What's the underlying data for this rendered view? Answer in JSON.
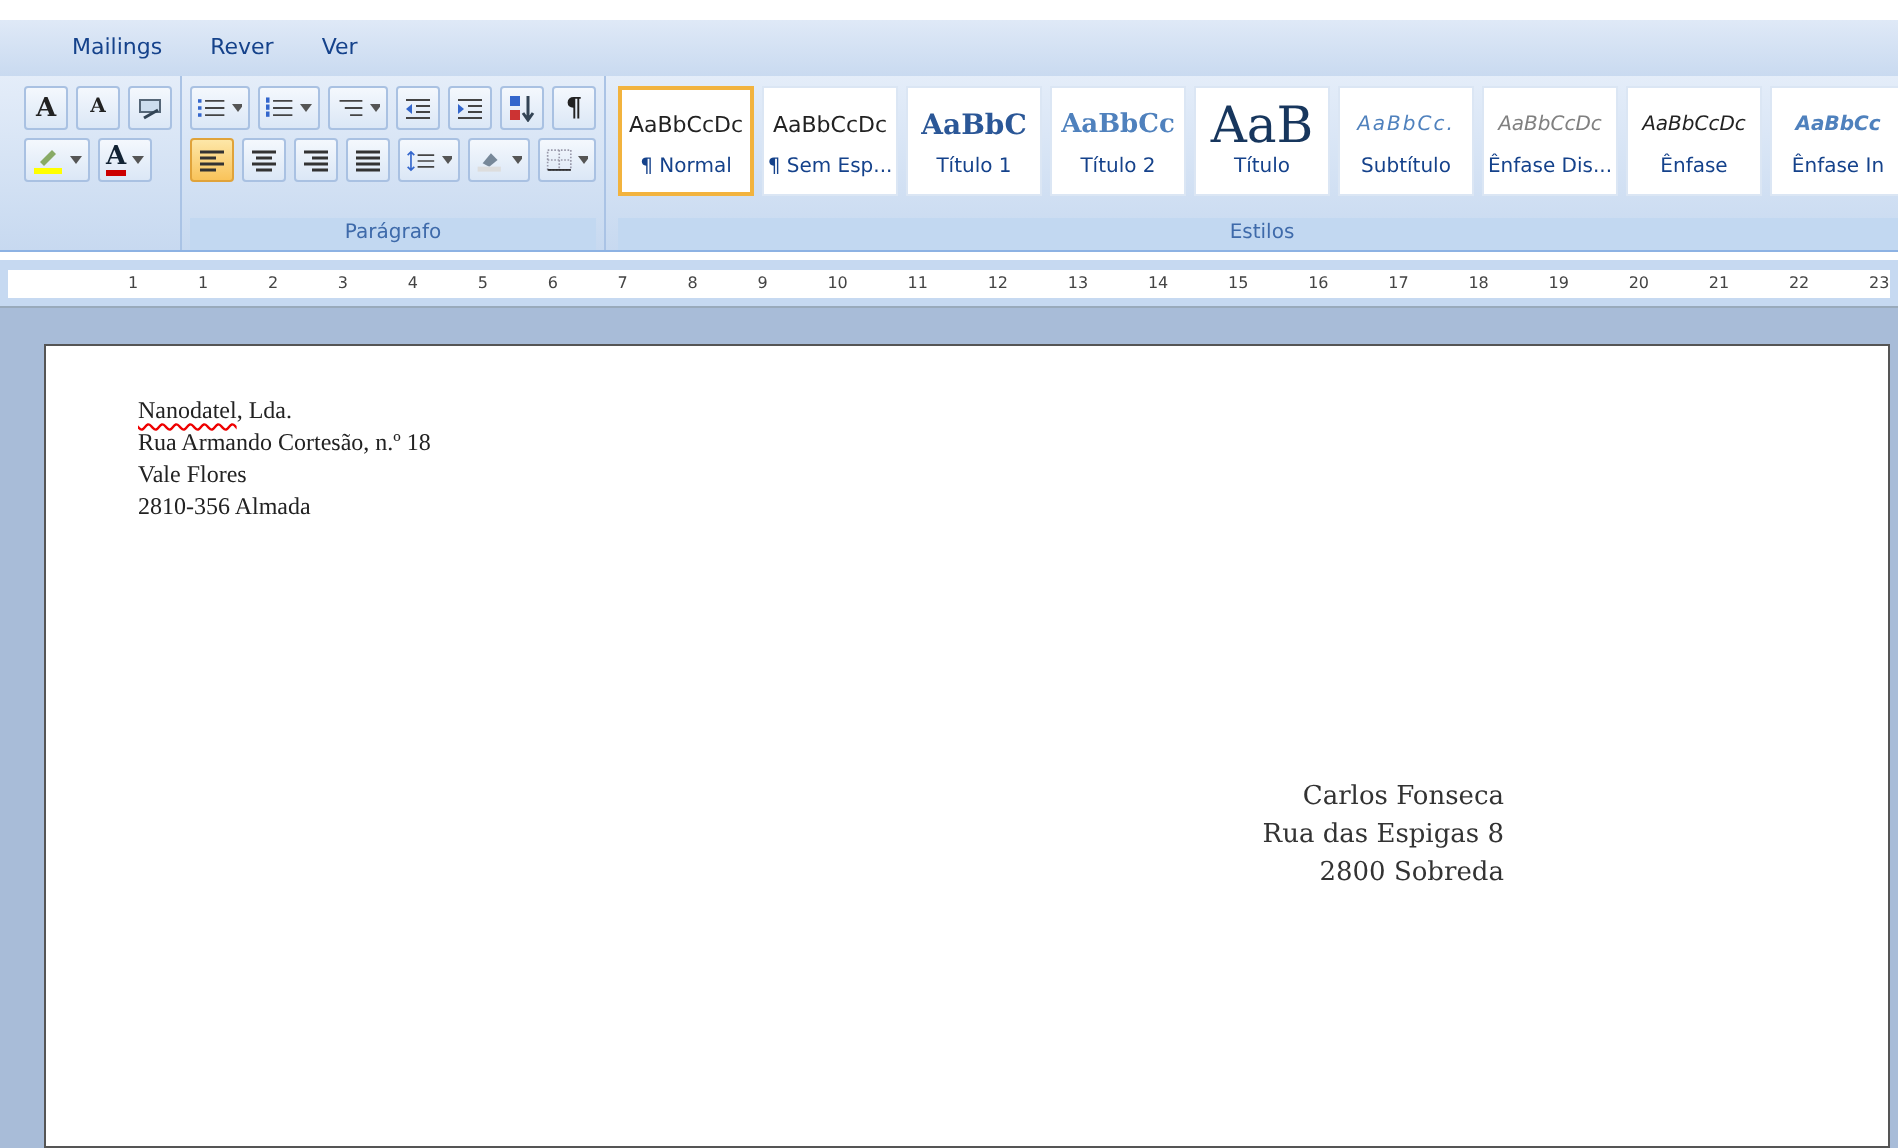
{
  "ribbon_tabs": [
    {
      "label": "Mailings",
      "selected": false
    },
    {
      "label": "Rever",
      "selected": false
    },
    {
      "label": "Ver",
      "selected": false
    }
  ],
  "font_group": {
    "row1": [
      {
        "kind": "grow",
        "label": "A"
      },
      {
        "kind": "shrink",
        "label": "A"
      },
      {
        "kind": "clear"
      }
    ],
    "row2": [
      {
        "kind": "highlight"
      },
      {
        "kind": "fontcolor",
        "label": "A"
      }
    ]
  },
  "paragraph_group": {
    "title": "Parágrafo",
    "row1": [
      {
        "kind": "bullets"
      },
      {
        "kind": "numbering"
      },
      {
        "kind": "multilevel"
      },
      {
        "kind": "outdent"
      },
      {
        "kind": "indent"
      },
      {
        "kind": "sort"
      },
      {
        "kind": "pilcrow",
        "label": "¶"
      }
    ],
    "row2": [
      {
        "kind": "align-left",
        "selected": true
      },
      {
        "kind": "center",
        "selected": false
      },
      {
        "kind": "align-right",
        "selected": false
      },
      {
        "kind": "justify",
        "selected": false
      },
      {
        "kind": "spacing"
      },
      {
        "kind": "shading"
      },
      {
        "kind": "borders"
      }
    ]
  },
  "styles_group": {
    "title": "Estilos",
    "items": [
      {
        "preview": "AaBbCcDc",
        "label": "¶ Normal",
        "kind": "normal",
        "selected": true
      },
      {
        "preview": "AaBbCcDc",
        "label": "¶ Sem Esp...",
        "kind": "normal",
        "selected": false
      },
      {
        "preview": "AaBbC",
        "label": "Título 1",
        "kind": "heading1",
        "selected": false
      },
      {
        "preview": "AaBbCc",
        "label": "Título 2",
        "kind": "heading2",
        "selected": false
      },
      {
        "preview": "AaB",
        "label": "Título",
        "kind": "title",
        "selected": false
      },
      {
        "preview": "AaBbCc.",
        "label": "Subtítulo",
        "kind": "subtitle",
        "selected": false
      },
      {
        "preview": "AaBbCcDc",
        "label": "Ênfase Dis...",
        "kind": "subtle",
        "selected": false
      },
      {
        "preview": "AaBbCcDc",
        "label": "Ênfase",
        "kind": "emphasis",
        "selected": false
      },
      {
        "preview": "AaBbCc",
        "label": "Ênfase In",
        "kind": "intense",
        "selected": false
      }
    ]
  },
  "ruler": {
    "labels": [
      "1",
      "1",
      "2",
      "3",
      "4",
      "5",
      "6",
      "7",
      "8",
      "9",
      "10",
      "11",
      "12",
      "13",
      "14",
      "15",
      "16",
      "17",
      "18",
      "19",
      "20",
      "21",
      "22",
      "23"
    ]
  },
  "document": {
    "sender": [
      [
        {
          "text": "Nanodatel",
          "misspelled": true
        },
        {
          "text": ", Lda.",
          "misspelled": false
        }
      ],
      [
        {
          "text": "Rua Armando Cortesão, n.º 18",
          "misspelled": false
        }
      ],
      [
        {
          "text": "Vale Flores",
          "misspelled": false
        }
      ],
      [
        {
          "text": "2810-356  Almada",
          "misspelled": false
        }
      ]
    ],
    "recipient": [
      "Carlos Fonseca",
      "Rua das Espigas 8",
      "2800 Sobreda"
    ]
  }
}
